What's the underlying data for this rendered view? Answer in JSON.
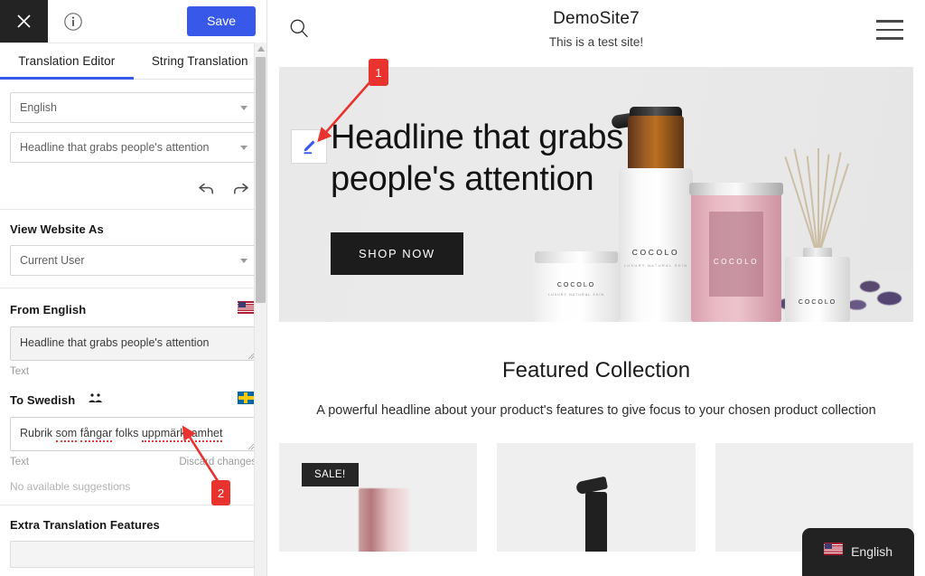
{
  "sidebar": {
    "topbar": {
      "close_icon": "close-icon",
      "info_icon": "info-circle-icon",
      "save_label": "Save"
    },
    "tabs": [
      {
        "label": "Translation Editor",
        "active": true
      },
      {
        "label": "String Translation",
        "active": false
      }
    ],
    "language_select": {
      "value": "English",
      "caret": "chevron-down-icon"
    },
    "string_select": {
      "value": "Headline that grabs people's attention",
      "caret": "chevron-down-icon"
    },
    "history": {
      "undo_icon": "undo-arrow-icon",
      "redo_icon": "redo-arrow-icon"
    },
    "view_website_as": {
      "title": "View Website As",
      "select_value": "Current User"
    },
    "source": {
      "title": "From English",
      "flag": "flag-united-states",
      "text": "Headline that grabs people's attention",
      "type_label": "Text"
    },
    "target": {
      "title": "To Swedish",
      "people_icon": "people-icon",
      "flag": "flag-sweden",
      "text_words": [
        {
          "word": "Rubrik",
          "misspelled": false
        },
        {
          "word": "som",
          "misspelled": true
        },
        {
          "word": "fångar",
          "misspelled": true
        },
        {
          "word": "folks",
          "misspelled": false
        },
        {
          "word": "uppmärksamhet",
          "misspelled": true
        }
      ],
      "text": "Rubrik som fångar folks uppmärksamhet",
      "type_label": "Text",
      "discard_label": "Discard changes",
      "suggestions_label": "No available suggestions"
    },
    "extra": {
      "title": "Extra Translation Features"
    },
    "scrollbar": {
      "name": "sidebar-vertical-scrollbar"
    }
  },
  "site": {
    "header": {
      "search_icon": "search-icon",
      "title": "DemoSite7",
      "tagline": "This is a test site!",
      "menu_icon": "hamburger-menu-icon"
    },
    "hero": {
      "edit_icon": "pencil-edit-icon",
      "headline": "Headline that grabs people's attention",
      "cta_label": "SHOP NOW",
      "product_labels": [
        "COCOLO",
        "COCOLO",
        "COCOLO",
        "COCOLO"
      ],
      "product_sublabel": "LUXURY NATURAL SKIN"
    },
    "featured": {
      "title": "Featured Collection",
      "subtitle": "A powerful headline about your product's features to give focus to your chosen product collection",
      "cards": [
        {
          "badge": "SALE!"
        },
        {
          "badge": ""
        },
        {
          "badge": ""
        }
      ]
    },
    "language_switcher": {
      "label": "English",
      "flag": "flag-united-states"
    }
  },
  "annotations": [
    {
      "id": "1",
      "label": "1"
    },
    {
      "id": "2",
      "label": "2"
    }
  ],
  "colors": {
    "accent_blue": "#3858e9",
    "marker_red": "#e8332e",
    "dark": "#232323",
    "hero_bg": "#e9e9e9"
  }
}
